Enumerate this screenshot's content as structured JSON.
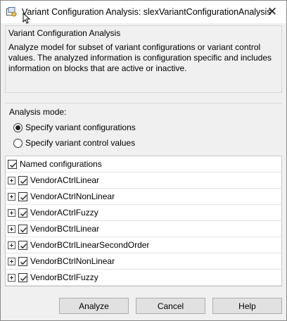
{
  "window": {
    "title": "Variant Configuration Analysis: slexVariantConfigurationAnalysis",
    "close_glyph": "✕"
  },
  "description": {
    "title": "Variant Configuration Analysis",
    "text": "Analyze model for subset of variant configurations or variant control values. The analyzed information is configuration specific and includes information on blocks that are active or inactive."
  },
  "analysis_mode": {
    "label": "Analysis mode:",
    "options": [
      {
        "label": "Specify variant configurations",
        "selected": true
      },
      {
        "label": "Specify variant control values",
        "selected": false
      }
    ]
  },
  "configurations": {
    "header": "Named configurations",
    "header_checked": true,
    "items": [
      {
        "label": "VendorACtrlLinear",
        "checked": true
      },
      {
        "label": "VendorACtrlNonLinear",
        "checked": true
      },
      {
        "label": "VendorACtrlFuzzy",
        "checked": true
      },
      {
        "label": "VendorBCtrlLinear",
        "checked": true
      },
      {
        "label": "VendorBCtrlLinearSecondOrder",
        "checked": true
      },
      {
        "label": "VendorBCtrlNonLinear",
        "checked": true
      },
      {
        "label": "VendorBCtrlFuzzy",
        "checked": true
      }
    ]
  },
  "buttons": {
    "analyze": "Analyze",
    "cancel": "Cancel",
    "help": "Help"
  },
  "icons": {
    "app": "variant-analysis-icon",
    "close": "close-icon",
    "cursor": "mouse-cursor-icon",
    "expand": "plus-expander-icon",
    "check": "checkmark-icon"
  }
}
